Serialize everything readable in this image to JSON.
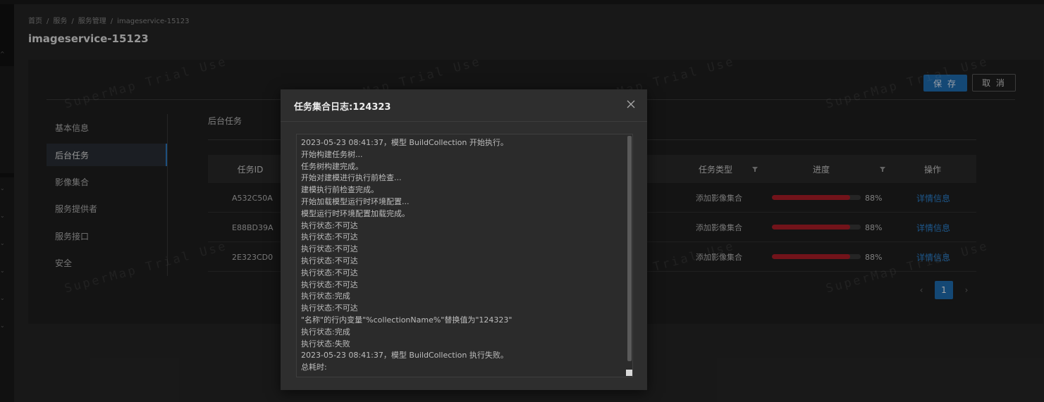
{
  "breadcrumb": {
    "items": [
      "首页",
      "服务",
      "服务管理",
      "imageservice-15123"
    ],
    "separator": "/"
  },
  "page": {
    "title": "imageservice-15123"
  },
  "toolbar": {
    "save_label": "保 存",
    "cancel_label": "取 消"
  },
  "sidenav": {
    "items": [
      {
        "label": "基本信息"
      },
      {
        "label": "后台任务"
      },
      {
        "label": "影像集合"
      },
      {
        "label": "服务提供者"
      },
      {
        "label": "服务接口"
      },
      {
        "label": "安全"
      }
    ],
    "active_index": 1
  },
  "section": {
    "title": "后台任务"
  },
  "table": {
    "columns": {
      "task_id": "任务ID",
      "task_type": "任务类型",
      "progress": "进度",
      "action": "操作"
    },
    "rows": [
      {
        "id": "A532C50A",
        "type": "添加影像集合",
        "progress": 0.88,
        "progress_label": "88%",
        "action": "详情信息"
      },
      {
        "id": "E88BD39A",
        "type": "添加影像集合",
        "progress": 0.88,
        "progress_label": "88%",
        "action": "详情信息"
      },
      {
        "id": "2E323CD0",
        "type": "添加影像集合",
        "progress": 0.88,
        "progress_label": "88%",
        "action": "详情信息"
      }
    ]
  },
  "pagination": {
    "current": "1",
    "prev_icon": "chevron-left-icon",
    "next_icon": "chevron-right-icon"
  },
  "watermark": {
    "text": "SuperMap Trial Use"
  },
  "modal": {
    "title": "任务集合日志:124323",
    "close_icon": "close-icon",
    "log_lines": [
      "2023-05-23 08:41:37，模型 BuildCollection 开始执行。",
      "开始构建任务树...",
      "任务树构建完成。",
      "开始对建模进行执行前检查...",
      "建模执行前检查完成。",
      "开始加载模型运行时环境配置...",
      "模型运行时环境配置加载完成。",
      "执行状态:不可达",
      "执行状态:不可达",
      "执行状态:不可达",
      "执行状态:不可达",
      "执行状态:不可达",
      "执行状态:不可达",
      "执行状态:完成",
      "执行状态:不可达",
      "\"名称\"的行内变量\"%collectionName%\"替换值为\"124323\"",
      "执行状态:完成",
      "执行状态:失败",
      "2023-05-23 08:41:37，模型 BuildCollection 执行失败。",
      "总耗时:"
    ]
  },
  "colors": {
    "accent": "#1f6fb4",
    "progress": "#b01e28",
    "link": "#2d86d6"
  }
}
